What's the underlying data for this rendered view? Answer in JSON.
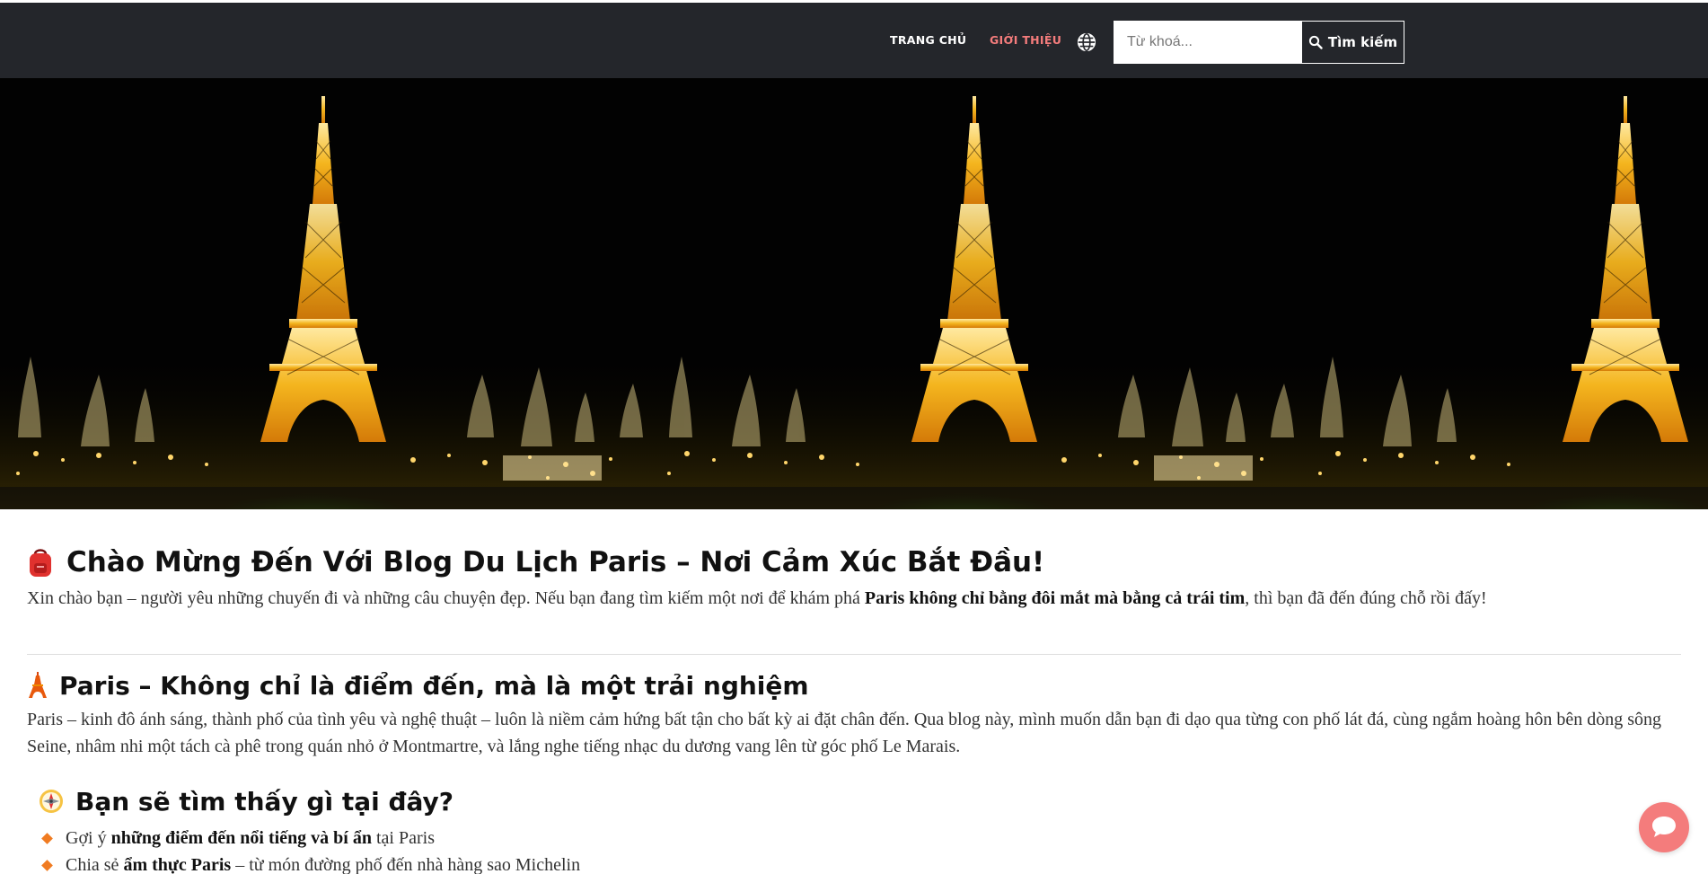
{
  "header": {
    "nav": {
      "home_label": "TRANG CHỦ",
      "about_label": "GIỚI THIỆU"
    },
    "language_icon": "globe-icon",
    "search": {
      "placeholder": "Từ khoá...",
      "value": "",
      "button_label": "Tìm kiếm",
      "button_icon": "search-icon"
    }
  },
  "hero": {
    "image_alt": "Tháp Eiffel về đêm"
  },
  "article": {
    "heading_1": {
      "icon": "backpack-icon",
      "text": "Chào Mừng Đến Với Blog Du Lịch Paris – Nơi Cảm Xúc Bắt Đầu!"
    },
    "intro": {
      "before": "Xin chào bạn – người yêu những chuyến đi và những câu chuyện đẹp. Nếu bạn đang tìm kiếm một nơi để khám phá ",
      "bold": "Paris không chỉ bằng đôi mắt mà bằng cả trái tim",
      "after": ", thì bạn đã đến đúng chỗ rồi đấy!"
    },
    "heading_2": {
      "icon": "eiffel-tower-icon",
      "text": "Paris – Không chỉ là điểm đến, mà là một trải nghiệm"
    },
    "paragraph_2": "Paris – kinh đô ánh sáng, thành phố của tình yêu và nghệ thuật – luôn là niềm cảm hứng bất tận cho bất kỳ ai đặt chân đến. Qua blog này, mình muốn dẫn bạn đi dạo qua từng con phố lát đá, cùng ngắm hoàng hôn bên dòng sông Seine, nhâm nhi một tách cà phê trong quán nhỏ ở Montmartre, và lắng nghe tiếng nhạc du dương vang lên từ góc phố Le Marais.",
    "heading_3": {
      "icon": "compass-icon",
      "text": "Bạn sẽ tìm thấy gì tại đây?"
    },
    "list": [
      {
        "before": "Gợi ý ",
        "bold": "những điểm đến nổi tiếng và bí ẩn",
        "after": " tại Paris"
      },
      {
        "before": "Chia sẻ ",
        "bold": "ẩm thực Paris",
        "after": " – từ món đường phố đến nhà hàng sao Michelin"
      }
    ]
  },
  "chat_widget": {
    "icon": "chat-bubble-icon"
  },
  "colors": {
    "header_bg": "#24262b",
    "accent": "#f47c7c",
    "bullet": "#f07b21"
  }
}
